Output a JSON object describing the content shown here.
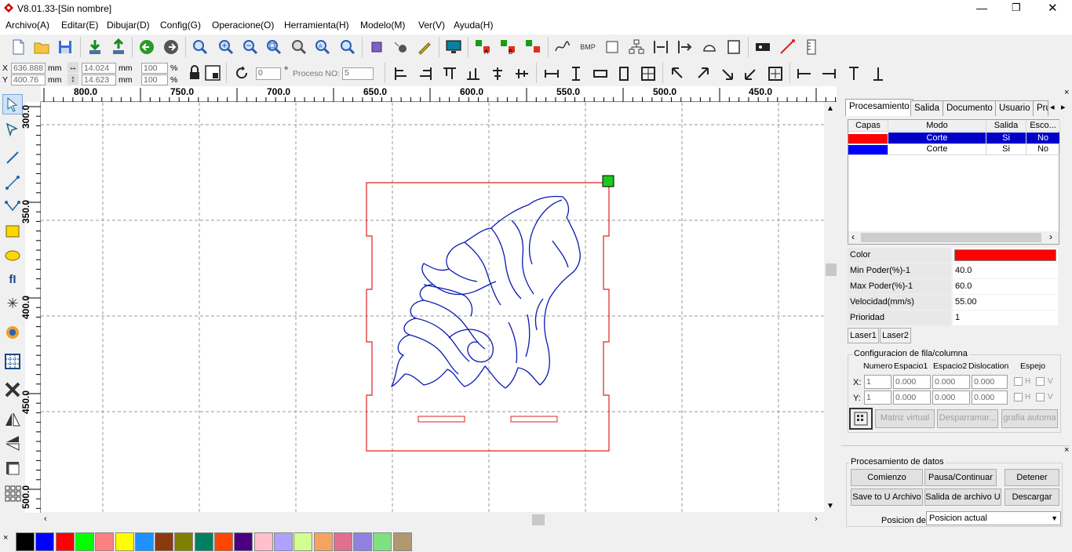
{
  "window": {
    "title": "V8.01.33-[Sin nombre]"
  },
  "menu": [
    "Archivo(A)",
    "Editar(E)",
    "Dibujar(D)",
    "Config(G)",
    "Operacione(O)",
    "Herramienta(H)",
    "Modelo(M)",
    "Ver(V)",
    "Ayuda(H)"
  ],
  "coords": {
    "x_label": "X",
    "y_label": "Y",
    "x_value": "636.888",
    "y_value": "400.76",
    "unit1": "mm",
    "unit2": "mm",
    "w_value": "14.024",
    "h_value": "14.623",
    "unit3": "mm",
    "unit4": "mm",
    "scale_x": "100",
    "scale_y": "100",
    "pct1": "%",
    "pct2": "%",
    "rotation": "0",
    "degree": "°",
    "proceso_label": "Proceso NO:",
    "proceso_value": "5"
  },
  "ruler_top": [
    "800.0",
    "750.0",
    "700.0",
    "650.0",
    "600.0",
    "550.0",
    "500.0",
    "450.0"
  ],
  "ruler_left": [
    "300.0",
    "350.0",
    "400.0",
    "450.0",
    "500.0"
  ],
  "palette": [
    "#000000",
    "#0000ff",
    "#ff0000",
    "#00ff00",
    "#ff8080",
    "#ffff00",
    "#1e90ff",
    "#8b3a0f",
    "#808000",
    "#008060",
    "#ff4500",
    "#4b0082",
    "#ffc0cb",
    "#b0a0ff",
    "#d0ff90",
    "#f4a460",
    "#e07090",
    "#9080e0",
    "#80e080",
    "#b09870"
  ],
  "panel": {
    "tabs": [
      "Procesamiento",
      "Salida",
      "Documento",
      "Usuario",
      "Pru"
    ],
    "layers_headers": [
      "Capas",
      "Modo",
      "Salida",
      "Esco..."
    ],
    "layers": [
      {
        "color": "#ff0000",
        "mode": "Corte",
        "output": "Si",
        "hide": "No"
      },
      {
        "color": "#0000ff",
        "mode": "Corte",
        "output": "Si",
        "hide": "No"
      }
    ],
    "props": [
      {
        "label": "Color",
        "value": ""
      },
      {
        "label": "Min Poder(%)-1",
        "value": "40.0"
      },
      {
        "label": "Max Poder(%)-1",
        "value": "60.0"
      },
      {
        "label": "Velocidad(mm/s)",
        "value": "55.00"
      },
      {
        "label": "Prioridad",
        "value": "1"
      }
    ],
    "prop_color": "#ff0000",
    "laser_tabs": [
      "Laser1",
      "Laser2"
    ],
    "array_group": "Configuracion de fila/columna",
    "array_headers": [
      "Numero",
      "Espacio1",
      "Espacio2",
      "Dislocation",
      "Espejo"
    ],
    "array_x_label": "X:",
    "array_y_label": "Y:",
    "array_x": [
      "1",
      "0.000",
      "0.000",
      "0.000"
    ],
    "array_y": [
      "1",
      "0.000",
      "0.000",
      "0.000"
    ],
    "mirror_h": "H",
    "mirror_v": "V",
    "array_buttons": [
      "Matriz virtual",
      "Desparramar...",
      "grafia automa"
    ]
  },
  "data_panel": {
    "group": "Procesamiento de datos",
    "buttons_row1": [
      "Comienzo",
      "Pausa/Continuar",
      "Detener"
    ],
    "buttons_row2": [
      "Save to U Archivo",
      "Salida de archivo U",
      "Descargar"
    ],
    "pos_label": "Posicion de",
    "pos_value": "Posicion actual"
  }
}
